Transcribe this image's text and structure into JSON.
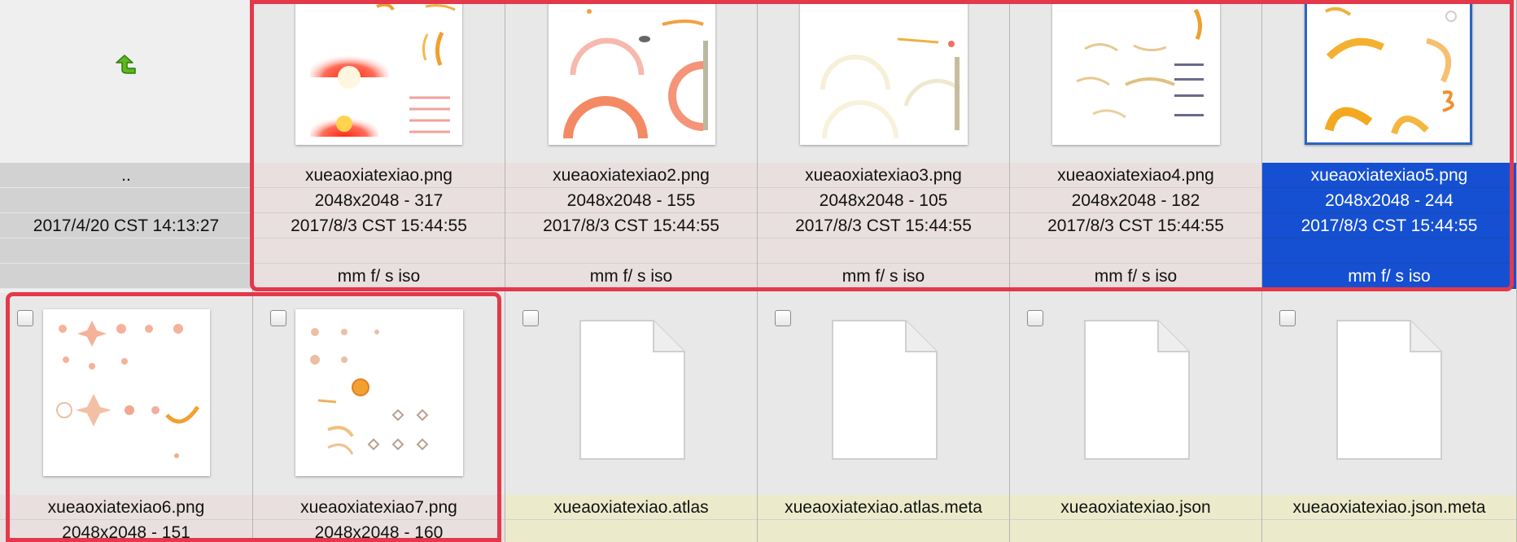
{
  "parent": {
    "name": "..",
    "date": "2017/4/20 CST 14:13:27"
  },
  "files_row1": [
    {
      "name": "xueaoxiatexiao.png",
      "size": "2048x2048 - 317",
      "date": "2017/8/3 CST 15:44:55",
      "exif": "mm f/ s iso"
    },
    {
      "name": "xueaoxiatexiao2.png",
      "size": "2048x2048 - 155",
      "date": "2017/8/3 CST 15:44:55",
      "exif": "mm f/ s iso"
    },
    {
      "name": "xueaoxiatexiao3.png",
      "size": "2048x2048 - 105",
      "date": "2017/8/3 CST 15:44:55",
      "exif": "mm f/ s iso"
    },
    {
      "name": "xueaoxiatexiao4.png",
      "size": "2048x2048 - 182",
      "date": "2017/8/3 CST 15:44:55",
      "exif": "mm f/ s iso"
    },
    {
      "name": "xueaoxiatexiao5.png",
      "size": "2048x2048 - 244",
      "date": "2017/8/3 CST 15:44:55",
      "exif": "mm f/ s iso"
    }
  ],
  "files_row2": [
    {
      "name": "xueaoxiatexiao6.png",
      "size": "2048x2048 - 151"
    },
    {
      "name": "xueaoxiatexiao7.png",
      "size": "2048x2048 - 160"
    },
    {
      "name": "xueaoxiatexiao.atlas"
    },
    {
      "name": "xueaoxiatexiao.atlas.meta"
    },
    {
      "name": "xueaoxiatexiao.json"
    },
    {
      "name": "xueaoxiatexiao.json.meta"
    }
  ],
  "colors": {
    "selection": "#1550d2",
    "highlight_border": "#e4384b",
    "up_arrow": "#5cb81e"
  },
  "icons": {
    "parent": "green-up-arrow-icon",
    "document": "generic-document-icon"
  }
}
